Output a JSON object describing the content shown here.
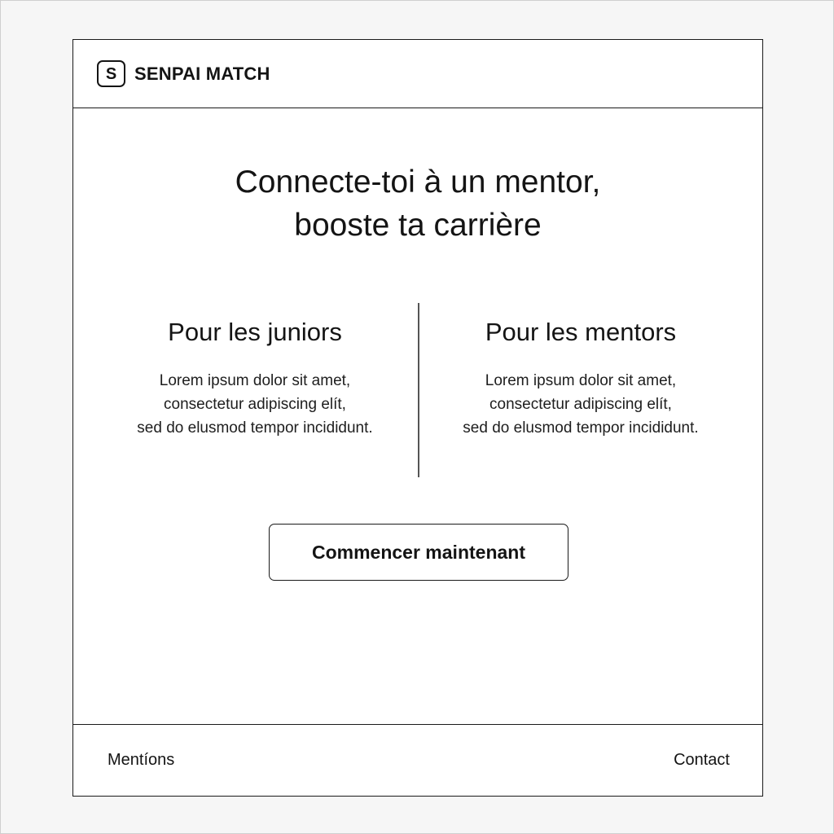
{
  "header": {
    "logo_letter": "S",
    "logo_icon": "s-logo-icon",
    "brand_name": "SENPAI MATCH"
  },
  "hero": {
    "title": "Connecte-toi à un mentor,\nbooste ta carrière"
  },
  "columns": [
    {
      "heading": "Pour les juniors",
      "text": "Lorem ipsum dolor sit amet,\nconsectetur adipiscing elít,\nsed do elusmod tempor incididunt."
    },
    {
      "heading": "Pour les mentors",
      "text": "Lorem ipsum dolor sit amet,\nconsectetur adipiscing elít,\nsed do elusmod tempor incididunt."
    }
  ],
  "cta": {
    "label": "Commencer maintenant"
  },
  "footer": {
    "left_link": "Mentíons",
    "right_link": "Contact"
  },
  "colors": {
    "background": "#f6f6f6",
    "card": "#ffffff",
    "ink": "#141414",
    "divider": "#555555"
  }
}
